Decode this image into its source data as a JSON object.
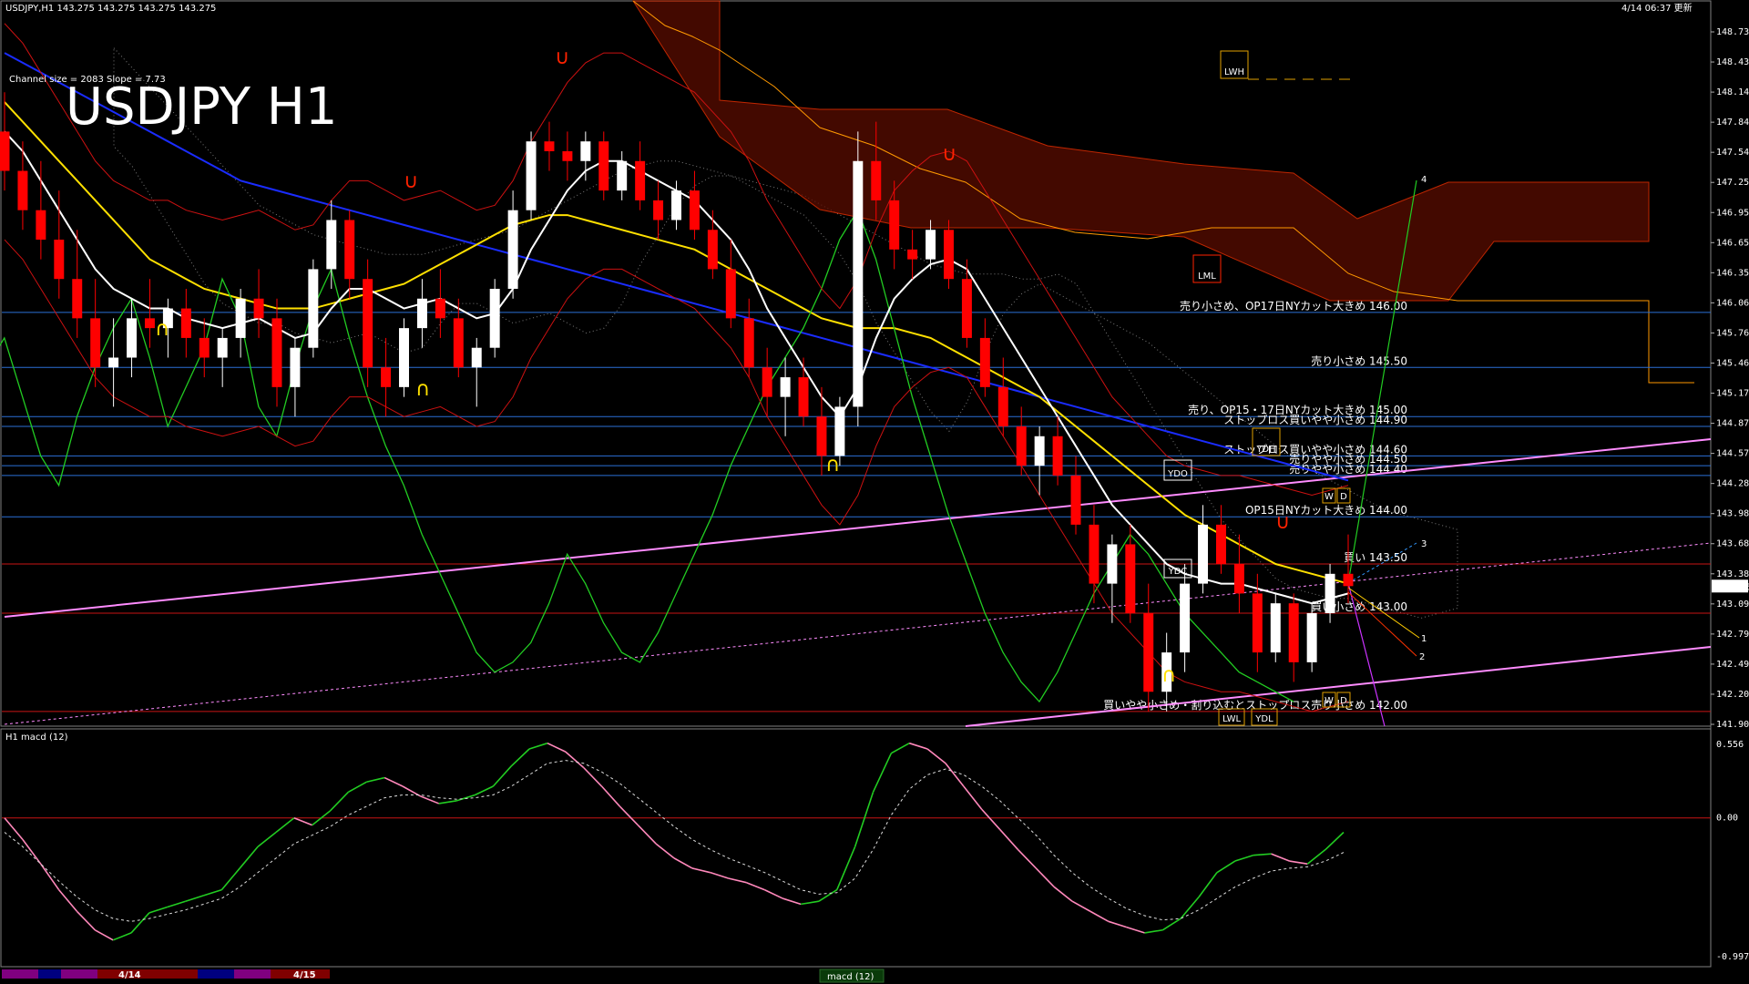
{
  "header": {
    "symbol_info": "USDJPY,H1  143.275 143.275 143.275 143.275",
    "datetime": "4/14 06:37 更新",
    "channel_info": "Channel size = 2083 Slope = 7.73",
    "chart_title": "USDJPY H1",
    "indicator_label": "H1 macd (12)",
    "bottom_tab": "macd (12)"
  },
  "colors": {
    "bull": "#ffffff",
    "bear": "#ff0000",
    "ma_fast": "#ffffff",
    "ma_mid": "#ffe000",
    "ma_slow": "#1a2cff",
    "green_line": "#22cc22",
    "pink": "#ff8cff",
    "cloud_white": "#bbbbbb",
    "cloud_red": "#ff3300",
    "grid_blue": "#2b6fd6",
    "grid_red": "#c81414"
  },
  "chart_data": {
    "type": "candlestick",
    "price_axis_ticks": [
      "148.735",
      "148.435",
      "148.140",
      "147.845",
      "147.545",
      "147.250",
      "146.950",
      "146.655",
      "146.355",
      "146.060",
      "145.760",
      "145.465",
      "145.170",
      "144.870",
      "144.575",
      "144.280",
      "143.980",
      "143.685",
      "143.385",
      "143.090",
      "142.790",
      "142.495",
      "142.200",
      "141.900"
    ],
    "current_price": "143.275",
    "macd_axis_ticks": [
      "0.556",
      "0.00",
      "-0.997"
    ],
    "date_labels": [
      "4/14",
      "4/15"
    ],
    "price_range": [
      141.85,
      149.0
    ],
    "macd_range": [
      -0.997,
      0.556
    ],
    "levels": [
      {
        "price": 146.06,
        "label": "売り小さめ、OP17日NYカット大きめ 146.00",
        "color": "blue"
      },
      {
        "price": 145.5,
        "label": "売り小さめ 145.50",
        "color": "blue"
      },
      {
        "price": 145.0,
        "label": "売り、OP15・17日NYカット大きめ 145.00",
        "color": "blue"
      },
      {
        "price": 144.9,
        "label": "ストップロス買いやや小さめ 144.90",
        "color": "blue"
      },
      {
        "price": 144.6,
        "label": "ストップロス買いやや小さめ 144.60",
        "color": "blue"
      },
      {
        "price": 144.5,
        "label": "売りやや小さめ 144.50",
        "color": "blue"
      },
      {
        "price": 144.4,
        "label": "売りやや小さめ 144.40",
        "color": "blue"
      },
      {
        "price": 143.98,
        "label": "OP15日NYカット大きめ 144.00",
        "color": "blue"
      },
      {
        "price": 143.5,
        "label": "買い 143.50",
        "color": "red"
      },
      {
        "price": 143.0,
        "label": "買い小さめ 143.00",
        "color": "red"
      },
      {
        "price": 142.0,
        "label": "買いやや小さめ・割り込むとストップロス売り小さめ 142.00",
        "color": "red"
      }
    ],
    "box_labels": [
      "LWH",
      "LML",
      "YDH",
      "YDO",
      "YDC",
      "LWL",
      "YDL",
      "W",
      "D",
      "W",
      "D"
    ],
    "projection_labels": [
      "1",
      "2",
      "3",
      "4"
    ],
    "candles": [
      [
        147.9,
        148.3,
        147.3,
        147.5
      ],
      [
        147.5,
        147.8,
        146.9,
        147.1
      ],
      [
        147.1,
        147.6,
        146.6,
        146.8
      ],
      [
        146.8,
        147.3,
        146.2,
        146.4
      ],
      [
        146.4,
        146.9,
        145.8,
        146.0
      ],
      [
        146.0,
        146.4,
        145.3,
        145.5
      ],
      [
        145.5,
        146.0,
        145.1,
        145.6
      ],
      [
        145.6,
        146.2,
        145.4,
        146.0
      ],
      [
        146.0,
        146.4,
        145.7,
        145.9
      ],
      [
        145.9,
        146.2,
        145.6,
        146.1
      ],
      [
        146.1,
        146.3,
        145.6,
        145.8
      ],
      [
        145.8,
        146.0,
        145.4,
        145.6
      ],
      [
        145.6,
        145.9,
        145.3,
        145.8
      ],
      [
        145.8,
        146.3,
        145.6,
        146.2
      ],
      [
        146.2,
        146.5,
        145.8,
        146.0
      ],
      [
        146.0,
        146.2,
        145.1,
        145.3
      ],
      [
        145.3,
        145.8,
        145.0,
        145.7
      ],
      [
        145.7,
        146.6,
        145.6,
        146.5
      ],
      [
        146.5,
        147.2,
        146.3,
        147.0
      ],
      [
        147.0,
        147.1,
        146.2,
        146.4
      ],
      [
        146.4,
        146.6,
        145.3,
        145.5
      ],
      [
        145.5,
        145.8,
        145.0,
        145.3
      ],
      [
        145.3,
        146.0,
        145.2,
        145.9
      ],
      [
        145.9,
        146.4,
        145.7,
        146.2
      ],
      [
        146.2,
        146.5,
        145.8,
        146.0
      ],
      [
        146.0,
        146.2,
        145.4,
        145.5
      ],
      [
        145.5,
        145.8,
        145.1,
        145.7
      ],
      [
        145.7,
        146.4,
        145.6,
        146.3
      ],
      [
        146.3,
        147.3,
        146.2,
        147.1
      ],
      [
        147.1,
        147.9,
        147.0,
        147.8
      ],
      [
        147.8,
        148.0,
        147.5,
        147.7
      ],
      [
        147.7,
        147.9,
        147.4,
        147.6
      ],
      [
        147.6,
        147.9,
        147.4,
        147.8
      ],
      [
        147.8,
        147.9,
        147.2,
        147.3
      ],
      [
        147.3,
        147.7,
        147.2,
        147.6
      ],
      [
        147.6,
        147.8,
        147.1,
        147.2
      ],
      [
        147.2,
        147.4,
        146.8,
        147.0
      ],
      [
        147.0,
        147.4,
        146.9,
        147.3
      ],
      [
        147.3,
        147.5,
        146.8,
        146.9
      ],
      [
        146.9,
        147.1,
        146.4,
        146.5
      ],
      [
        146.5,
        146.8,
        145.9,
        146.0
      ],
      [
        146.0,
        146.2,
        145.4,
        145.5
      ],
      [
        145.5,
        145.7,
        145.0,
        145.2
      ],
      [
        145.2,
        145.6,
        144.8,
        145.4
      ],
      [
        145.4,
        145.6,
        144.9,
        145.0
      ],
      [
        145.0,
        145.3,
        144.4,
        144.6
      ],
      [
        144.6,
        145.2,
        144.5,
        145.1
      ],
      [
        145.1,
        147.9,
        144.9,
        147.6
      ],
      [
        147.6,
        148.0,
        147.0,
        147.2
      ],
      [
        147.2,
        147.4,
        146.5,
        146.7
      ],
      [
        146.7,
        146.9,
        146.4,
        146.6
      ],
      [
        146.6,
        147.0,
        146.5,
        146.9
      ],
      [
        146.9,
        147.0,
        146.3,
        146.4
      ],
      [
        146.4,
        146.6,
        145.7,
        145.8
      ],
      [
        145.8,
        146.0,
        145.2,
        145.3
      ],
      [
        145.3,
        145.6,
        144.8,
        144.9
      ],
      [
        144.9,
        145.1,
        144.4,
        144.5
      ],
      [
        144.5,
        144.9,
        144.2,
        144.8
      ],
      [
        144.8,
        145.0,
        144.3,
        144.4
      ],
      [
        144.4,
        144.6,
        143.8,
        143.9
      ],
      [
        143.9,
        144.1,
        143.1,
        143.3
      ],
      [
        143.3,
        143.8,
        142.9,
        143.7
      ],
      [
        143.7,
        143.9,
        142.9,
        143.0
      ],
      [
        143.0,
        143.3,
        142.0,
        142.2
      ],
      [
        142.2,
        142.8,
        142.0,
        142.6
      ],
      [
        142.6,
        143.5,
        142.4,
        143.3
      ],
      [
        143.3,
        144.1,
        143.2,
        143.9
      ],
      [
        143.9,
        144.1,
        143.4,
        143.5
      ],
      [
        143.5,
        143.8,
        143.0,
        143.2
      ],
      [
        143.2,
        143.4,
        142.4,
        142.6
      ],
      [
        142.6,
        143.2,
        142.5,
        143.1
      ],
      [
        143.1,
        143.2,
        142.3,
        142.5
      ],
      [
        142.5,
        143.1,
        142.4,
        143.0
      ],
      [
        143.0,
        143.5,
        142.9,
        143.4
      ],
      [
        143.4,
        143.8,
        143.1,
        143.275
      ]
    ],
    "ma_white": [
      147.9,
      147.7,
      147.4,
      147.1,
      146.8,
      146.5,
      146.3,
      146.2,
      146.1,
      146.1,
      146.0,
      145.95,
      145.9,
      145.95,
      146.0,
      145.9,
      145.8,
      145.85,
      146.1,
      146.3,
      146.3,
      146.2,
      146.1,
      146.15,
      146.2,
      146.1,
      146.0,
      146.05,
      146.3,
      146.7,
      147.0,
      147.3,
      147.5,
      147.6,
      147.6,
      147.5,
      147.4,
      147.3,
      147.2,
      147.0,
      146.8,
      146.5,
      146.1,
      145.8,
      145.5,
      145.2,
      145.0,
      145.3,
      145.8,
      146.2,
      146.4,
      146.55,
      146.6,
      146.5,
      146.2,
      145.9,
      145.6,
      145.3,
      145.0,
      144.7,
      144.4,
      144.1,
      143.9,
      143.7,
      143.5,
      143.4,
      143.35,
      143.3,
      143.3,
      143.25,
      143.2,
      143.15,
      143.1,
      143.15,
      143.2
    ],
    "ma_yellow": [
      148.2,
      148.0,
      147.8,
      147.6,
      147.4,
      147.2,
      147.0,
      146.8,
      146.6,
      146.5,
      146.4,
      146.3,
      146.25,
      146.2,
      146.15,
      146.1,
      146.1,
      146.1,
      146.15,
      146.2,
      146.25,
      146.3,
      146.35,
      146.45,
      146.55,
      146.65,
      146.75,
      146.85,
      146.95,
      147.0,
      147.05,
      147.05,
      147.0,
      146.95,
      146.9,
      146.85,
      146.8,
      146.75,
      146.7,
      146.6,
      146.5,
      146.4,
      146.3,
      146.2,
      146.1,
      146.0,
      145.95,
      145.9,
      145.9,
      145.9,
      145.85,
      145.8,
      145.7,
      145.6,
      145.5,
      145.4,
      145.3,
      145.2,
      145.05,
      144.9,
      144.75,
      144.6,
      144.45,
      144.3,
      144.15,
      144.0,
      143.9,
      143.8,
      143.7,
      143.6,
      143.5,
      143.45,
      143.4,
      143.35,
      143.3
    ],
    "ma_blue": [
      148.7,
      148.6,
      148.5,
      148.4,
      148.3,
      148.2,
      148.1,
      148.0,
      147.9,
      147.8,
      147.7,
      147.6,
      147.5,
      147.4,
      147.35,
      147.3,
      147.25,
      147.2,
      147.15,
      147.1,
      147.05,
      147.0,
      146.95,
      146.9,
      146.85,
      146.8,
      146.75,
      146.7,
      146.65,
      146.6,
      146.55,
      146.5,
      146.45,
      146.4,
      146.35,
      146.3,
      146.25,
      146.2,
      146.15,
      146.1,
      146.05,
      146.0,
      145.95,
      145.9,
      145.85,
      145.8,
      145.75,
      145.7,
      145.65,
      145.6,
      145.55,
      145.5,
      145.45,
      145.4,
      145.35,
      145.3,
      145.25,
      145.2,
      145.15,
      145.1,
      145.05,
      145.0,
      144.95,
      144.9,
      144.85,
      144.8,
      144.75,
      144.7,
      144.65,
      144.6,
      144.55,
      144.5,
      144.45,
      144.4,
      144.35
    ],
    "green_line": [
      146.5,
      146.3,
      145.5,
      145.8,
      145.2,
      144.6,
      144.3,
      145.0,
      145.5,
      145.9,
      146.2,
      145.6,
      144.9,
      145.3,
      145.7,
      146.4,
      146.0,
      145.1,
      144.8,
      145.5,
      146.1,
      146.5,
      145.8,
      145.2,
      144.7,
      144.3,
      143.8,
      143.4,
      143.0,
      142.6,
      142.4,
      142.5,
      142.7,
      143.1,
      143.6,
      143.3,
      142.9,
      142.6,
      142.5,
      142.8,
      143.2,
      143.6,
      144.0,
      144.5,
      144.9,
      145.3,
      145.6,
      145.9,
      146.3,
      146.8,
      147.1,
      146.6,
      145.9,
      145.2,
      144.6,
      144.0,
      143.5,
      143.0,
      142.6,
      142.3,
      142.1,
      142.4,
      142.8,
      143.2,
      143.5,
      143.8,
      143.6,
      143.3,
      143.0,
      142.8,
      142.6,
      142.4,
      142.3,
      142.2,
      142.1
    ],
    "macd": [
      0.0,
      -0.15,
      -0.32,
      -0.5,
      -0.65,
      -0.78,
      -0.85,
      -0.8,
      -0.66,
      -0.62,
      -0.58,
      -0.54,
      -0.5,
      -0.35,
      -0.2,
      -0.1,
      0.0,
      -0.05,
      0.05,
      0.18,
      0.25,
      0.28,
      0.22,
      0.15,
      0.1,
      0.12,
      0.16,
      0.22,
      0.36,
      0.48,
      0.52,
      0.46,
      0.35,
      0.22,
      0.08,
      -0.05,
      -0.18,
      -0.28,
      -0.35,
      -0.38,
      -0.42,
      -0.45,
      -0.5,
      -0.56,
      -0.6,
      -0.58,
      -0.5,
      -0.2,
      0.18,
      0.45,
      0.52,
      0.48,
      0.38,
      0.22,
      0.06,
      -0.08,
      -0.22,
      -0.35,
      -0.48,
      -0.58,
      -0.65,
      -0.72,
      -0.76,
      -0.8,
      -0.78,
      -0.7,
      -0.55,
      -0.38,
      -0.3,
      -0.26,
      -0.25,
      -0.3,
      -0.32,
      -0.22,
      -0.1
    ],
    "macd_signal": [
      -0.1,
      -0.2,
      -0.32,
      -0.44,
      -0.55,
      -0.64,
      -0.7,
      -0.72,
      -0.7,
      -0.67,
      -0.64,
      -0.6,
      -0.56,
      -0.48,
      -0.38,
      -0.28,
      -0.18,
      -0.12,
      -0.06,
      0.02,
      0.08,
      0.14,
      0.16,
      0.16,
      0.14,
      0.13,
      0.14,
      0.16,
      0.22,
      0.3,
      0.38,
      0.4,
      0.38,
      0.32,
      0.24,
      0.14,
      0.04,
      -0.06,
      -0.15,
      -0.22,
      -0.28,
      -0.33,
      -0.38,
      -0.44,
      -0.5,
      -0.53,
      -0.52,
      -0.42,
      -0.22,
      0.02,
      0.2,
      0.3,
      0.34,
      0.3,
      0.22,
      0.12,
      0.0,
      -0.12,
      -0.26,
      -0.38,
      -0.48,
      -0.56,
      -0.63,
      -0.68,
      -0.71,
      -0.7,
      -0.64,
      -0.56,
      -0.48,
      -0.42,
      -0.37,
      -0.35,
      -0.34,
      -0.3,
      -0.24
    ]
  }
}
